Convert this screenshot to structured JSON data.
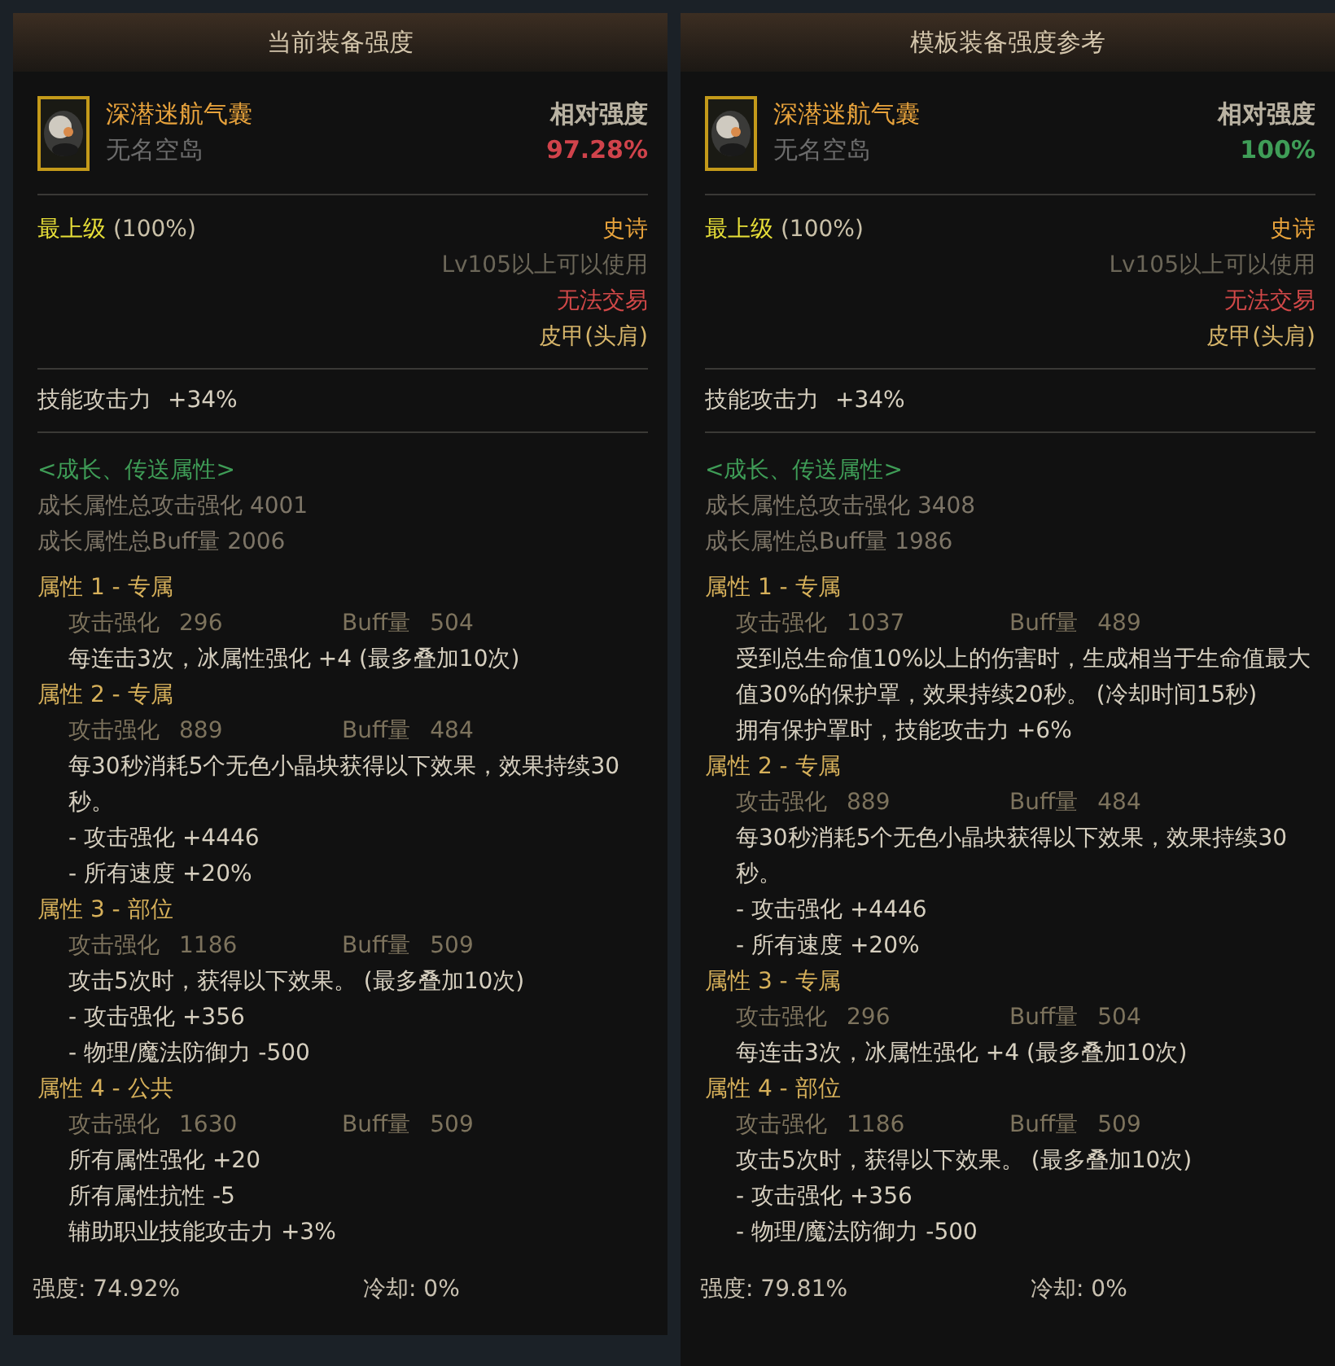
{
  "panels": [
    {
      "title": "当前装备强度",
      "item": {
        "name": "深潜迷航气囊",
        "source": "无名空岛"
      },
      "relative": {
        "label": "相对强度",
        "value": "97.28%",
        "color": "#d0434b"
      },
      "grade": {
        "label": "最上级",
        "pct": "(100%)"
      },
      "rarity": "史诗",
      "level_req": "Lv105以上可以使用",
      "trade": "无法交易",
      "type": "皮甲(头肩)",
      "skill": {
        "label": "技能攻击力",
        "value": "+34%"
      },
      "growth": {
        "header": "<成长、传送属性>",
        "lines": [
          "成长属性总攻击强化 4001",
          "成长属性总Buff量 2006"
        ]
      },
      "attributes": [
        {
          "title": "属性 1 - 专属",
          "atk_label": "攻击强化",
          "atk": "296",
          "buff_label": "Buff量",
          "buff": "504",
          "effects": [
            "每连击3次，冰属性强化 +4 (最多叠加10次)"
          ]
        },
        {
          "title": "属性 2 - 专属",
          "atk_label": "攻击强化",
          "atk": "889",
          "buff_label": "Buff量",
          "buff": "484",
          "effects": [
            "每30秒消耗5个无色小晶块获得以下效果，效果持续30秒。",
            "- 攻击强化 +4446",
            "- 所有速度 +20%"
          ]
        },
        {
          "title": "属性 3 - 部位",
          "atk_label": "攻击强化",
          "atk": "1186",
          "buff_label": "Buff量",
          "buff": "509",
          "effects": [
            "攻击5次时，获得以下效果。 (最多叠加10次)",
            "- 攻击强化 +356",
            "- 物理/魔法防御力 -500"
          ]
        },
        {
          "title": "属性 4 - 公共",
          "atk_label": "攻击强化",
          "atk": "1630",
          "buff_label": "Buff量",
          "buff": "509",
          "effects": [
            "所有属性强化 +20",
            "所有属性抗性 -5",
            "辅助职业技能攻击力 +3%"
          ]
        }
      ],
      "footer": {
        "strength": "强度: 74.92%",
        "cooldown": "冷却: 0%"
      }
    },
    {
      "title": "模板装备强度参考",
      "item": {
        "name": "深潜迷航气囊",
        "source": "无名空岛"
      },
      "relative": {
        "label": "相对强度",
        "value": "100%",
        "color": "#3f9d57"
      },
      "grade": {
        "label": "最上级",
        "pct": "(100%)"
      },
      "rarity": "史诗",
      "level_req": "Lv105以上可以使用",
      "trade": "无法交易",
      "type": "皮甲(头肩)",
      "skill": {
        "label": "技能攻击力",
        "value": "+34%"
      },
      "growth": {
        "header": "<成长、传送属性>",
        "lines": [
          "成长属性总攻击强化 3408",
          "成长属性总Buff量 1986"
        ]
      },
      "attributes": [
        {
          "title": "属性 1 - 专属",
          "atk_label": "攻击强化",
          "atk": "1037",
          "buff_label": "Buff量",
          "buff": "489",
          "effects": [
            "受到总生命值10%以上的伤害时，生成相当于生命值最大值30%的保护罩，效果持续20秒。 (冷却时间15秒)",
            "拥有保护罩时，技能攻击力 +6%"
          ]
        },
        {
          "title": "属性 2 - 专属",
          "atk_label": "攻击强化",
          "atk": "889",
          "buff_label": "Buff量",
          "buff": "484",
          "effects": [
            "每30秒消耗5个无色小晶块获得以下效果，效果持续30秒。",
            "- 攻击强化 +4446",
            "- 所有速度 +20%"
          ]
        },
        {
          "title": "属性 3 - 专属",
          "atk_label": "攻击强化",
          "atk": "296",
          "buff_label": "Buff量",
          "buff": "504",
          "effects": [
            "每连击3次，冰属性强化 +4 (最多叠加10次)"
          ]
        },
        {
          "title": "属性 4 - 部位",
          "atk_label": "攻击强化",
          "atk": "1186",
          "buff_label": "Buff量",
          "buff": "509",
          "effects": [
            "攻击5次时，获得以下效果。 (最多叠加10次)",
            "- 攻击强化 +356",
            "- 物理/魔法防御力 -500"
          ]
        }
      ],
      "footer": {
        "strength": "强度: 79.81%",
        "cooldown": "冷却: 0%"
      }
    }
  ]
}
